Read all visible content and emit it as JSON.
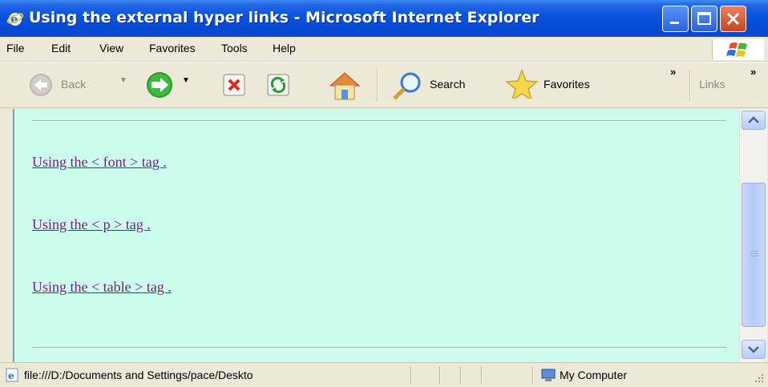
{
  "window": {
    "title": "Using the external hyper links - Microsoft Internet Explorer"
  },
  "menu": {
    "items": [
      "File",
      "Edit",
      "View",
      "Favorites",
      "Tools",
      "Help"
    ]
  },
  "toolbar": {
    "back_label": "Back",
    "search_label": "Search",
    "favorites_label": "Favorites",
    "chevron": "»",
    "links_label": "Links"
  },
  "content": {
    "background": "#ccfcec",
    "links": [
      "Using the < font > tag .",
      "Using the < p > tag .",
      "Using the < table > tag ."
    ]
  },
  "status": {
    "url": "file:///D:/Documents and Settings/pace/Deskto",
    "zone": "My Computer"
  },
  "colors": {
    "titlebar": "#0a55e0",
    "link": "#7b1c8c"
  }
}
